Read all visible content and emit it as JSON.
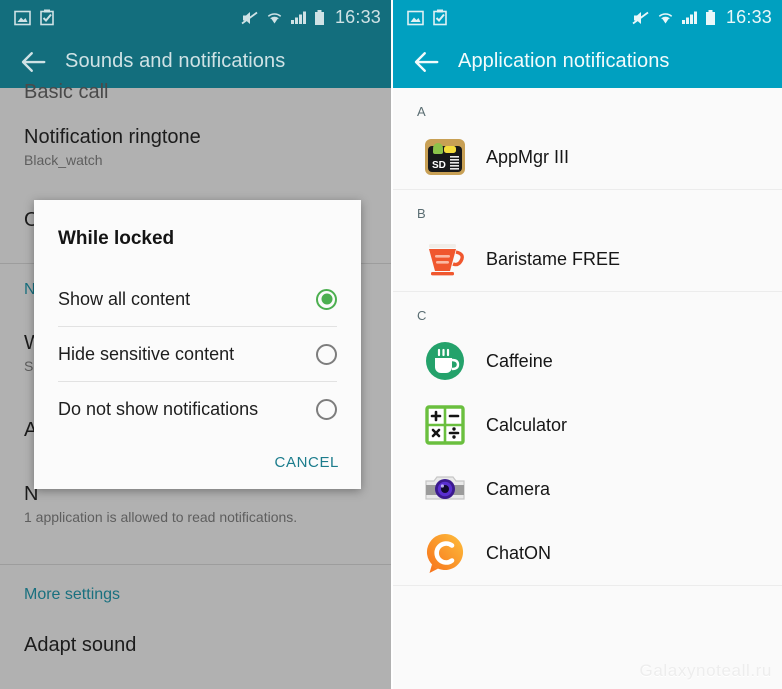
{
  "status_bar": {
    "time": "16:33",
    "left_icons": [
      "picture-icon",
      "clipboard-check-icon"
    ],
    "right_icons": [
      "mute-icon",
      "wifi-icon",
      "signal-icon",
      "battery-icon"
    ]
  },
  "colors": {
    "left_header": "#136e7d",
    "right_header": "#00a0c0",
    "accent_teal": "#1b7c8c",
    "radio_selected_green": "#4caf50",
    "dim_background": "#b1b1b1"
  },
  "left_panel": {
    "title": "Sounds and notifications",
    "back_label": "Back",
    "clipped_top_item": "Basic call",
    "items": [
      {
        "title": "Notification ringtone",
        "subtitle": "Black_watch"
      },
      {
        "title": "O",
        "subtitle": ""
      },
      {
        "title": "No",
        "subtitle": ""
      },
      {
        "title": "W",
        "subtitle": "Sh"
      },
      {
        "title": "A",
        "subtitle": ""
      },
      {
        "title": "N",
        "subtitle": "1 application is allowed to read notifications."
      }
    ],
    "more_settings": "More settings",
    "adapt_sound": "Adapt sound"
  },
  "dialog": {
    "title": "While locked",
    "options": [
      {
        "label": "Show all content",
        "selected": true
      },
      {
        "label": "Hide sensitive content",
        "selected": false
      },
      {
        "label": "Do not show notifications",
        "selected": false
      }
    ],
    "cancel_label": "CANCEL"
  },
  "right_panel": {
    "title": "Application notifications",
    "back_label": "Back",
    "watermark": "Galaxynoteall.ru",
    "sections": [
      {
        "letter": "A",
        "apps": [
          {
            "name": "AppMgr III",
            "icon": "appmgr-icon"
          }
        ]
      },
      {
        "letter": "B",
        "apps": [
          {
            "name": "Baristame FREE",
            "icon": "coffee-cup-icon"
          }
        ]
      },
      {
        "letter": "C",
        "apps": [
          {
            "name": "Caffeine",
            "icon": "caffeine-icon"
          },
          {
            "name": "Calculator",
            "icon": "calculator-icon"
          },
          {
            "name": "Camera",
            "icon": "camera-icon"
          },
          {
            "name": "ChatON",
            "icon": "chaton-icon"
          }
        ]
      }
    ]
  }
}
